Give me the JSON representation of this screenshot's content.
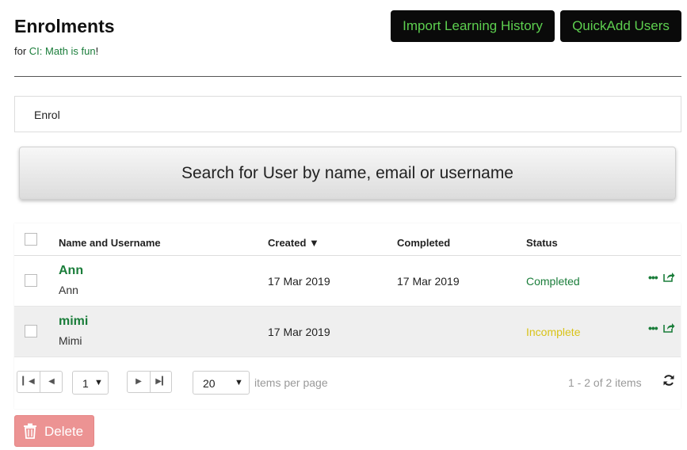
{
  "header": {
    "title": "Enrolments",
    "subtitle_prefix": "for ",
    "course_name": "CI: Math is fun",
    "subtitle_suffix": "!",
    "import_label": "Import Learning History",
    "quickadd_label": "QuickAdd Users"
  },
  "enrol": {
    "label": "Enrol",
    "search_label": "Search for User by name, email or username"
  },
  "grid": {
    "columns": [
      "Name and Username",
      "Created ▼",
      "Completed",
      "Status"
    ],
    "rows": [
      {
        "name": "Ann",
        "username": "Ann",
        "created": "17 Mar 2019",
        "completed": "17 Mar 2019",
        "status": "Completed"
      },
      {
        "name": "mimi",
        "username": "Mimi",
        "created": "17 Mar 2019",
        "completed": "",
        "status": "Incomplete"
      }
    ],
    "actions": {
      "more_icon": "ellipsis-icon",
      "open_icon": "share-icon"
    }
  },
  "pager": {
    "current_page": "1",
    "page_size": "20",
    "items_per_page_label": "items per page",
    "summary": "1 - 2 of 2 items"
  },
  "footer": {
    "delete_label": "Delete"
  },
  "colors": {
    "accent_green": "#1a7d3a",
    "header_button_bg": "#0a0a0a",
    "header_button_text": "#5dcf4f",
    "incomplete": "#d9c318",
    "delete_bg": "#ec9393"
  }
}
